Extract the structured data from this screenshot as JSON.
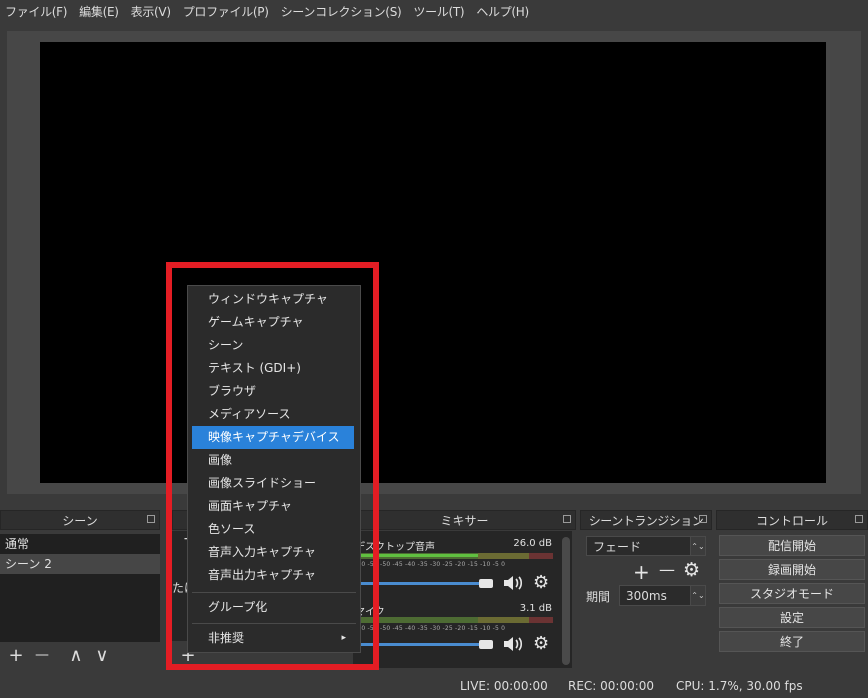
{
  "menubar": [
    "ファイル(F)",
    "編集(E)",
    "表示(V)",
    "プロファイル(P)",
    "シーンコレクション(S)",
    "ツール(T)",
    "ヘルプ(H)"
  ],
  "scenes": {
    "title": "シーン",
    "items": [
      "通常",
      "シーン 2"
    ],
    "toolbar": {
      "add": "+",
      "remove": "—",
      "up": "∧",
      "down": "∨"
    }
  },
  "sources": {
    "hint_char_1": "+",
    "hint_char_2": "たは"
  },
  "mixer": {
    "title": "ミキサー",
    "tracks": [
      {
        "name": "デスクトップ音声",
        "db": "26.0 dB",
        "level": 0.62,
        "volume": 0.93
      },
      {
        "name": "マイク",
        "db": "3.1 dB",
        "level": 0.0,
        "volume": 0.93
      }
    ],
    "ticks": "-60 -55 -50 -45 -40 -35 -30 -25 -20 -15 -10 -5 0"
  },
  "transitions": {
    "title": "シーントランジション",
    "selected": "フェード",
    "duration_label": "期間",
    "duration_value": "300ms"
  },
  "controls": {
    "title": "コントロール",
    "buttons": [
      "配信開始",
      "録画開始",
      "スタジオモード",
      "設定",
      "終了"
    ]
  },
  "status": {
    "live": "LIVE: 00:00:00",
    "rec": "REC: 00:00:00",
    "cpu": "CPU: 1.7%, 30.00 fps"
  },
  "context_menu": {
    "items": [
      "ウィンドウキャプチャ",
      "ゲームキャプチャ",
      "シーン",
      "テキスト (GDI+)",
      "ブラウザ",
      "メディアソース",
      "映像キャプチャデバイス",
      "画像",
      "画像スライドショー",
      "画面キャプチャ",
      "色ソース",
      "音声入力キャプチャ",
      "音声出力キャプチャ"
    ],
    "highlighted_index": 6,
    "group": "グループ化",
    "deprecated": "非推奨",
    "submenu_arrow": "▸"
  },
  "annotation": {
    "color": "#e31d24"
  }
}
